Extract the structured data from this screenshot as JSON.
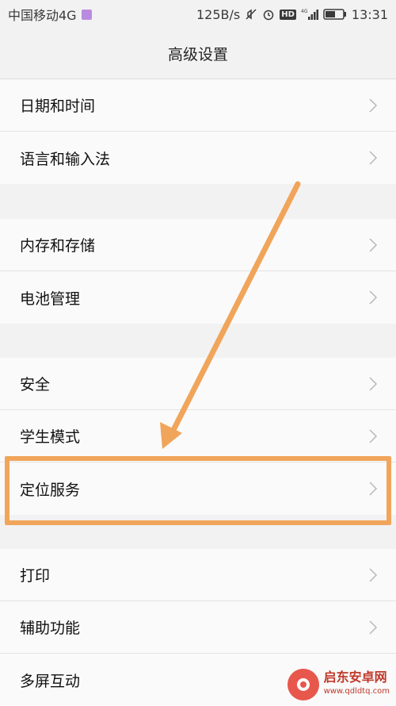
{
  "status_bar": {
    "carrier": "中国移动4G",
    "speed": "125B/s",
    "hd": "HD",
    "network": "4G",
    "time": "13:31"
  },
  "header": {
    "title": "高级设置"
  },
  "groups": [
    {
      "items": [
        {
          "label": "日期和时间"
        },
        {
          "label": "语言和输入法"
        }
      ]
    },
    {
      "items": [
        {
          "label": "内存和存储"
        },
        {
          "label": "电池管理"
        }
      ]
    },
    {
      "items": [
        {
          "label": "安全"
        },
        {
          "label": "学生模式"
        },
        {
          "label": "定位服务"
        }
      ]
    },
    {
      "items": [
        {
          "label": "打印"
        },
        {
          "label": "辅助功能"
        },
        {
          "label": "多屏互动"
        }
      ]
    }
  ],
  "annotation": {
    "color": "#f0a55b",
    "highlighted_item": "定位服务"
  },
  "watermark": {
    "name": "启东安卓网",
    "url": "www.qdldtq.com"
  }
}
